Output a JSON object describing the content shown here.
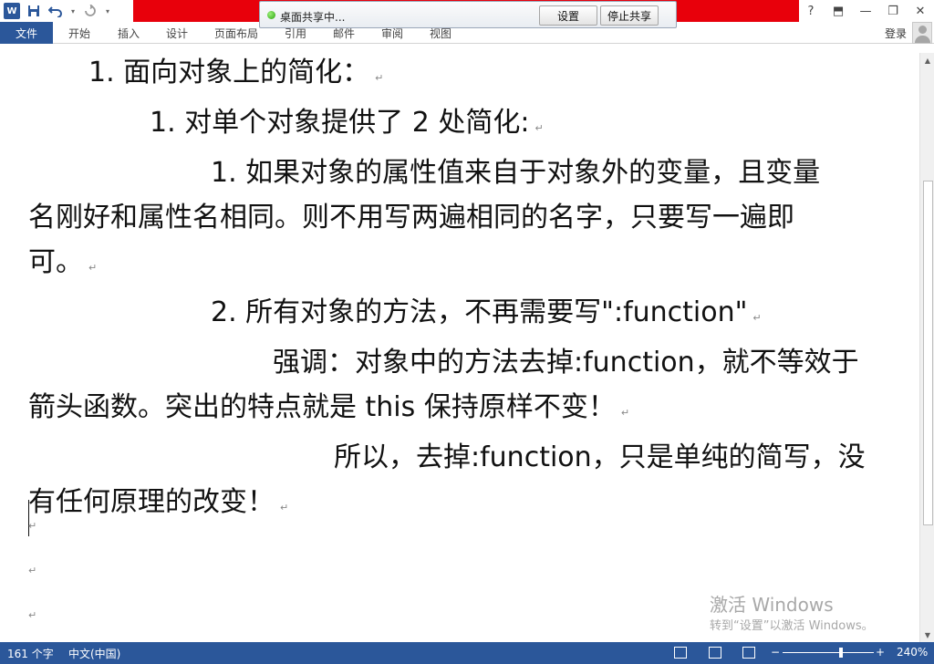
{
  "titlebar": {
    "app_logo": "W",
    "icons": [
      "word-logo-icon",
      "save-icon",
      "undo-icon",
      "redo-icon",
      "customize-icon"
    ],
    "window_controls": {
      "help": "?",
      "ribbon_display": "⬒",
      "minimize": "—",
      "restore": "❐",
      "close": "✕"
    },
    "accent_color": "#e8000b"
  },
  "share": {
    "status": "桌面共享中...",
    "settings_label": "设置",
    "stop_label": "停止共享"
  },
  "ribbon": {
    "file_tab": "文件",
    "tabs": [
      "开始",
      "插入",
      "设计",
      "页面布局",
      "引用",
      "邮件",
      "审阅",
      "视图"
    ],
    "login": "登录",
    "brand_color": "#2b579a"
  },
  "document": {
    "lines": [
      "1.  面向对象上的简化：",
      "1.  对单个对象提供了 2 处简化:",
      "1.  如果对象的属性值来自于对象外的变量，且变量",
      "名刚好和属性名相同。则不用写两遍相同的名字，只要写一遍即",
      "可。",
      "2.  所有对象的方法，不再需要写\":function\"",
      "强调：对象中的方法去掉:function，就不等效于",
      "箭头函数。突出的特点就是 this 保持原样不变！",
      "所以，去掉:function，只是单纯的简写，没",
      "有任何原理的改变！"
    ],
    "paragraph_mark": "↵"
  },
  "watermark": {
    "title": "激活 Windows",
    "subtitle": "转到“设置”以激活 Windows。"
  },
  "statusbar": {
    "word_count": "161 个字",
    "language": "中文(中国)",
    "zoom_minus": "−",
    "zoom_plus": "+",
    "zoom_level": "240%"
  }
}
